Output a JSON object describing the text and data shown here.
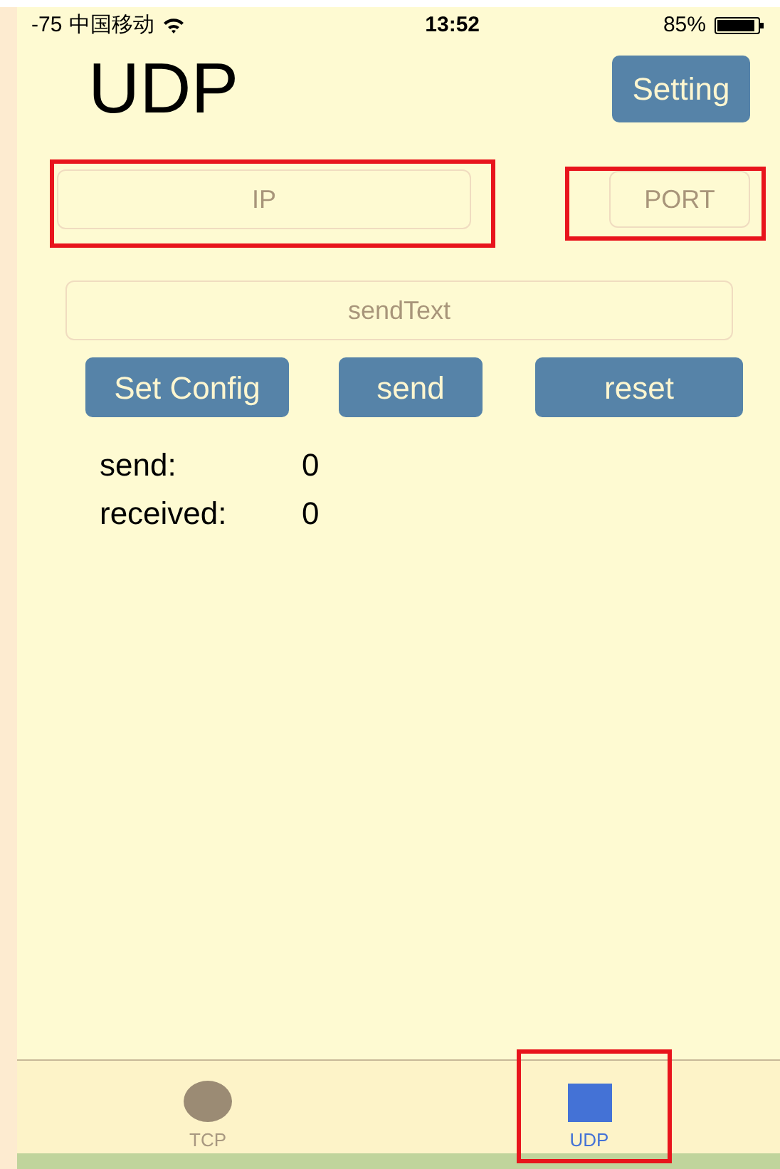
{
  "status_bar": {
    "signal": "-75",
    "carrier": "中国移动",
    "time": "13:52",
    "battery": "85%"
  },
  "title": "UDP",
  "setting_button": "Setting",
  "fields": [
    {
      "placeholder": "IP",
      "highlighted": true
    },
    {
      "placeholder": "PORT",
      "highlighted": true
    }
  ],
  "send_field": {
    "placeholder": "sendText"
  },
  "buttons": [
    "Set Config",
    "send",
    "reset"
  ],
  "counters": [
    {
      "label": "send:",
      "value": "0"
    },
    {
      "label": "received:",
      "value": "0"
    }
  ],
  "tabs": [
    {
      "label": "TCP",
      "kind": "circle",
      "selected": false,
      "highlighted": false
    },
    {
      "label": "UDP",
      "kind": "square",
      "selected": true,
      "highlighted": true
    }
  ]
}
